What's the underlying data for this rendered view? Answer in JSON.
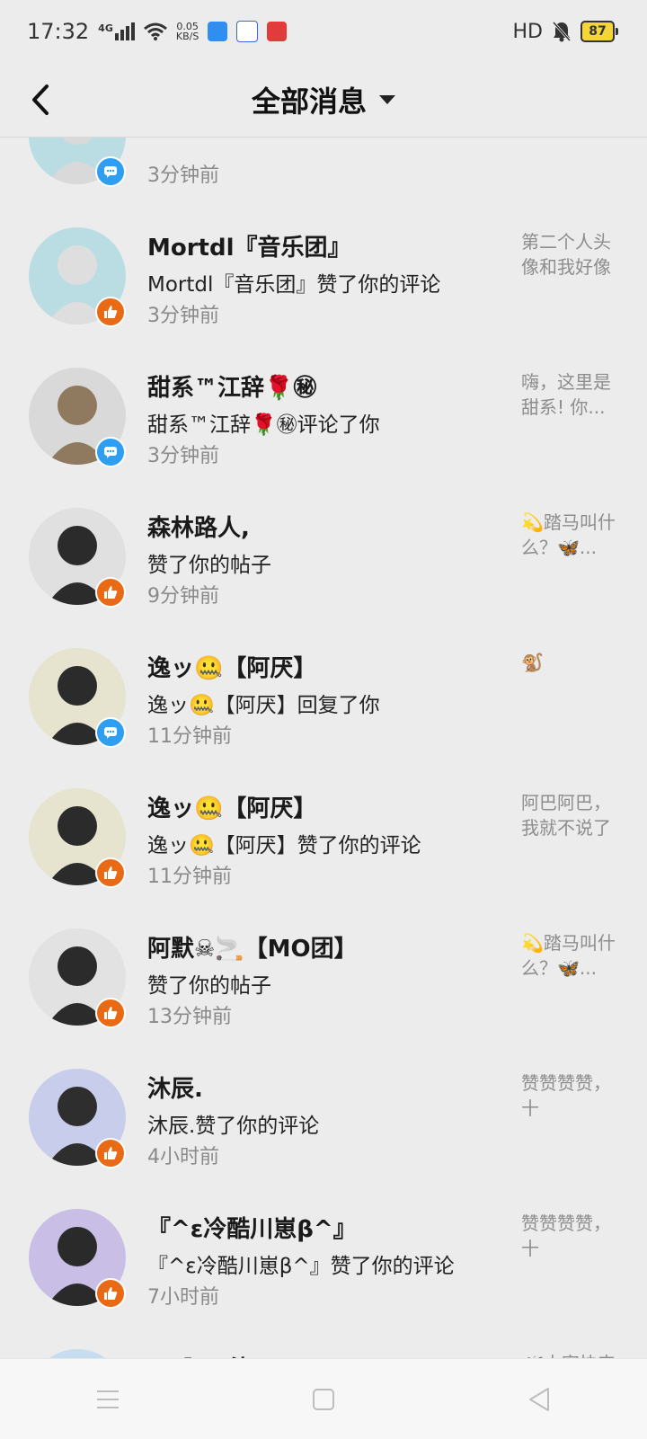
{
  "status_bar": {
    "time": "17:32",
    "network": "4G",
    "speed_value": "0.05",
    "speed_unit": "KB/S",
    "hd": "HD",
    "battery": "87"
  },
  "header": {
    "title": "全部消息"
  },
  "notifications": [
    {
      "name": "",
      "action": "",
      "time": "3分钟前",
      "preview": "",
      "badge": "comment"
    },
    {
      "name": "Mortdl『音乐团』",
      "action": "Mortdl『音乐团』赞了你的评论",
      "time": "3分钟前",
      "preview": "第二个人头像和我好像",
      "badge": "like"
    },
    {
      "name": "甜系™江辞🌹㊙",
      "action": "甜系™江辞🌹㊙评论了你",
      "time": "3分钟前",
      "preview": "嗨，这里是甜系! 你...",
      "badge": "comment"
    },
    {
      "name": "森林路人,",
      "action": "赞了你的帖子",
      "time": "9分钟前",
      "preview": "💫踏马叫什么？🦋...",
      "badge": "like"
    },
    {
      "name": "逸ッ🤐【阿厌】",
      "action": "逸ッ🤐【阿厌】回复了你",
      "time": "11分钟前",
      "preview": "🐒",
      "badge": "comment"
    },
    {
      "name": "逸ッ🤐【阿厌】",
      "action": "逸ッ🤐【阿厌】赞了你的评论",
      "time": "11分钟前",
      "preview": "阿巴阿巴，我就不说了",
      "badge": "like"
    },
    {
      "name": "阿默☠🚬【MO团】",
      "action": "赞了你的帖子",
      "time": "13分钟前",
      "preview": "💫踏马叫什么？🦋...",
      "badge": "like"
    },
    {
      "name": "沐辰.",
      "action": "沐辰.赞了你的评论",
      "time": "4小时前",
      "preview": "赞赞赞赞，十",
      "badge": "like"
    },
    {
      "name": "『^ε冷酷川崽β^』",
      "action": "『^ε冷酷川崽β^』赞了你的评论",
      "time": "7小时前",
      "preview": "赞赞赞赞，十",
      "badge": "like"
    },
    {
      "name": "𝓜-阿™染",
      "action": "",
      "time": "",
      "preview": "🦋大家快来",
      "badge": ""
    }
  ],
  "colors": {
    "like_badge": "#e96a14",
    "comment_badge": "#2e9ef2",
    "background": "#ececec"
  },
  "icons": {
    "back": "chevron-left-icon",
    "dropdown": "caret-down-icon",
    "like": "thumbs-up-icon",
    "comment": "chat-bubble-icon",
    "nav_menu": "menu-icon",
    "nav_home": "square-home-icon",
    "nav_back": "triangle-back-icon"
  }
}
